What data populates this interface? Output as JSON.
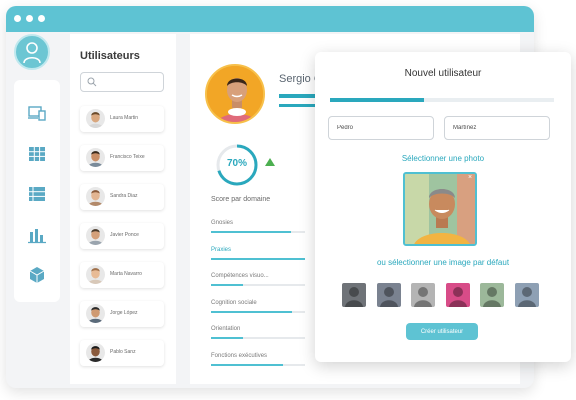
{
  "users_panel": {
    "title": "Utilisateurs",
    "users": [
      {
        "name": "Laura Martin",
        "skin": "#d9a77e",
        "hair": "#6b4a2a",
        "shirt": "#d7d7d7"
      },
      {
        "name": "Francisco Teixe",
        "skin": "#c98e66",
        "hair": "#3a2a1c",
        "shirt": "#7a8b9a"
      },
      {
        "name": "Sandra Diaz",
        "skin": "#e2b592",
        "hair": "#8a5a3a",
        "shirt": "#b38a6a"
      },
      {
        "name": "Javier Ponce",
        "skin": "#d4a07a",
        "hair": "#4a3a2a",
        "shirt": "#9aa4ae"
      },
      {
        "name": "Marta Navarro",
        "skin": "#e8bb96",
        "hair": "#a0704a",
        "shirt": "#d8c8b8"
      },
      {
        "name": "Jorge López",
        "skin": "#cf9a72",
        "hair": "#2a2a2a",
        "shirt": "#5a6a7a"
      },
      {
        "name": "Pablo Sanz",
        "skin": "#8a5a3c",
        "hair": "#1a1a1a",
        "shirt": "#2a2a2a"
      }
    ]
  },
  "profile": {
    "name": "Sergio C",
    "score_percent": 70,
    "score_text": "70%",
    "score_label": "Score par domaine",
    "domains": [
      {
        "label": "Gnosies",
        "value": 85,
        "active": false
      },
      {
        "label": "Praxies",
        "value": 100,
        "active": true
      },
      {
        "label": "Compétences visuo...",
        "value": 34,
        "active": false
      },
      {
        "label": "Cognition sociale",
        "value": 86,
        "active": false
      },
      {
        "label": "Orientation",
        "value": 34,
        "active": false
      },
      {
        "label": "Fonctions exécutives",
        "value": 77,
        "active": false
      }
    ]
  },
  "modal": {
    "title": "Nouvel utilisateur",
    "progress_percent": 42,
    "first_name_value": "Pedro",
    "last_name_value": "Martínez",
    "select_photo_label": "Sélectionner une photo",
    "photo_close": "×",
    "default_image_label": "ou sélectionner une image par défaut",
    "default_avatar_colors": [
      "#6f7378",
      "#7a8290",
      "#b4b4b4",
      "#d84c88",
      "#9cb89a",
      "#8ea0b4"
    ],
    "create_button": "Créer utilisateur"
  },
  "colors": {
    "accent": "#2aa8bd",
    "titlebar": "#5ec3d3",
    "success": "#4caf50"
  }
}
